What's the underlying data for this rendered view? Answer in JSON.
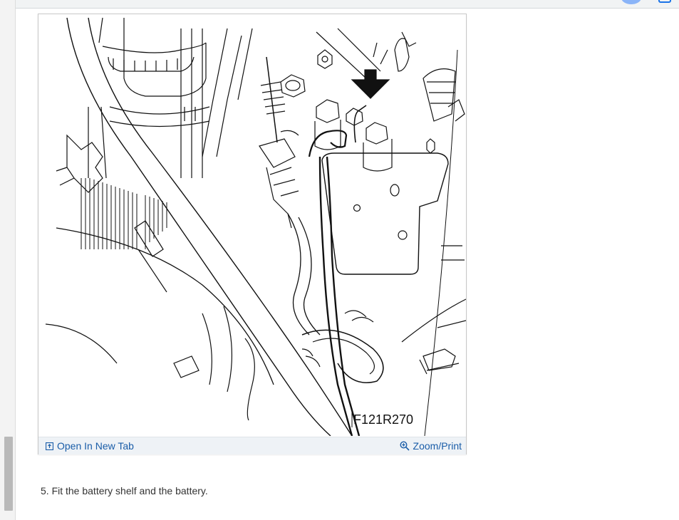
{
  "figure": {
    "code": "F121R270",
    "open_tab_label": "Open In New Tab",
    "zoom_label": "Zoom/Print",
    "icons": {
      "open": "open-new-tab-icon",
      "zoom": "zoom-in-icon"
    }
  },
  "step": {
    "text": "5. Fit the battery shelf and the battery."
  },
  "colors": {
    "link": "#1a5da8",
    "footer_bg": "#eef2f6"
  }
}
